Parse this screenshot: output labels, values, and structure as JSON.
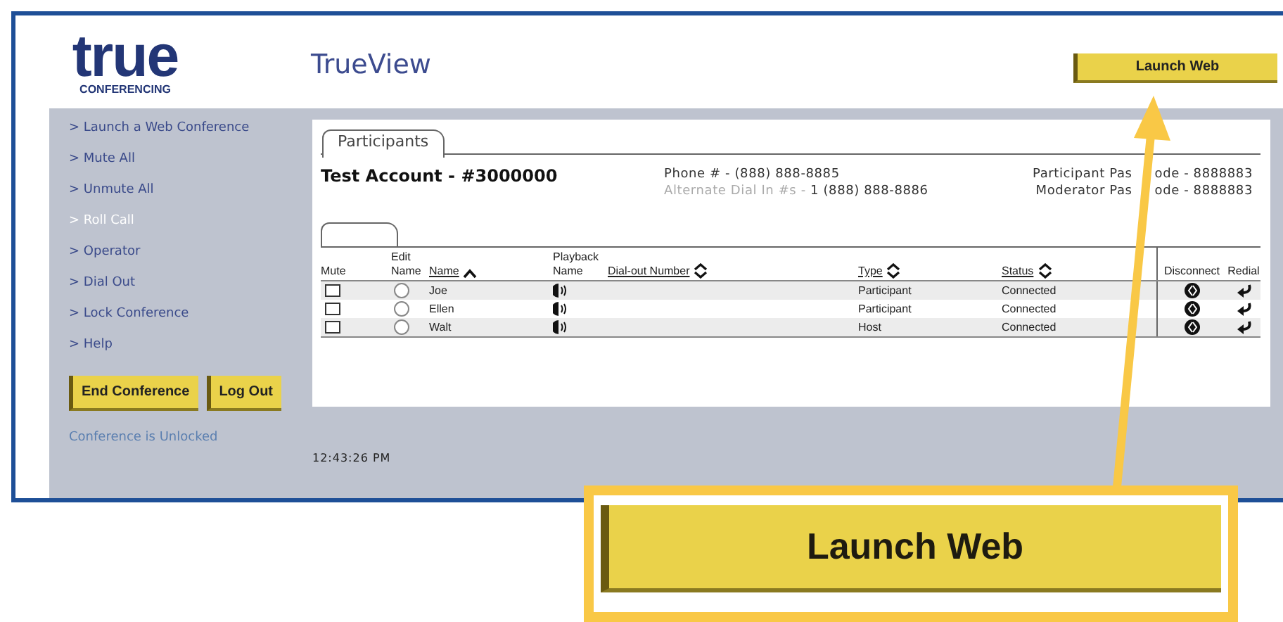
{
  "header": {
    "logo": {
      "word": "true",
      "tagline": "CONFERENCING"
    },
    "title": "TrueView",
    "launch_button": "Launch Web"
  },
  "sidebar": {
    "items": [
      {
        "label": "> Launch a Web Conference",
        "disabled": false
      },
      {
        "label": "> Mute All",
        "disabled": false
      },
      {
        "label": "> Unmute All",
        "disabled": false
      },
      {
        "label": "> Roll Call",
        "disabled": true
      },
      {
        "label": "> Operator",
        "disabled": false
      },
      {
        "label": "> Dial Out",
        "disabled": false
      },
      {
        "label": "> Lock Conference",
        "disabled": false
      },
      {
        "label": "> Help",
        "disabled": false
      }
    ],
    "buttons": [
      "End Conference",
      "Log Out"
    ],
    "lock_status": "Conference is Unlocked"
  },
  "tabs": [
    {
      "label": "Participants",
      "selected": true
    }
  ],
  "account": "Test Account - #3000000",
  "phone": {
    "label": "Phone # - ",
    "value": "(888) 888-8885"
  },
  "alternate": {
    "label": "Alternate Dial In #s - ",
    "value": "1 (888) 888-8886"
  },
  "passcodes": [
    {
      "before": "Participant Pas",
      "after": "ode - 8888883"
    },
    {
      "before": "Moderator Pas",
      "after": "ode - 8888883"
    }
  ],
  "columns": [
    {
      "label": "Mute",
      "sortable": false,
      "sorted": false,
      "link": false
    },
    {
      "label": "Edit Name",
      "sortable": false,
      "sorted": false,
      "link": false
    },
    {
      "label": "Name",
      "sortable": true,
      "sorted": true,
      "link": true
    },
    {
      "label": "Playback Name",
      "sortable": false,
      "sorted": false,
      "link": false
    },
    {
      "label": "Dial-out Number",
      "sortable": true,
      "sorted": false,
      "link": true
    },
    {
      "label": "Type",
      "sortable": true,
      "sorted": false,
      "link": true
    },
    {
      "label": "Status",
      "sortable": true,
      "sorted": false,
      "link": true
    },
    {
      "label": "Disconnect",
      "sortable": false,
      "sorted": false,
      "link": false
    },
    {
      "label": "Redial",
      "sortable": false,
      "sorted": false,
      "link": false
    }
  ],
  "rows": [
    {
      "muted": false,
      "selected": false,
      "name": "Joe",
      "type": "Participant",
      "status": "Connected"
    },
    {
      "muted": false,
      "selected": false,
      "name": "Ellen",
      "type": "Participant",
      "status": "Connected"
    },
    {
      "muted": false,
      "selected": false,
      "name": "Walt",
      "type": "Host",
      "status": "Connected"
    }
  ],
  "clock": "12:43:26 PM",
  "callout": {
    "label": "Launch Web"
  }
}
